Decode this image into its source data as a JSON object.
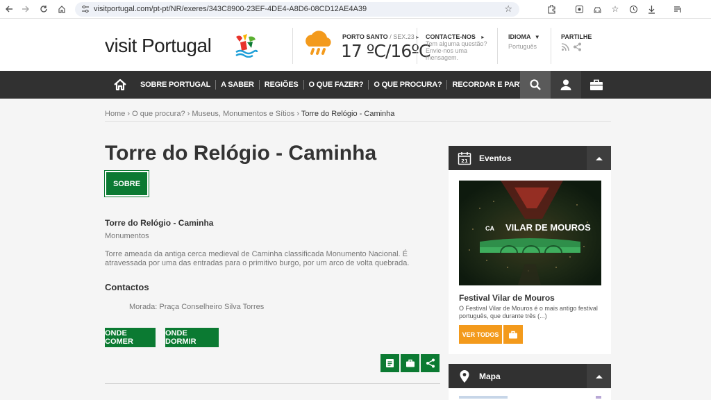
{
  "browser": {
    "url": "visitportugal.com/pt-pt/NR/exeres/343C8900-23EF-4DE4-A8D6-08CD12AE4A39"
  },
  "header": {
    "logo_text": "visit Portugal",
    "weather": {
      "city": "PORTO SANTO",
      "date": "/ SEX.23",
      "temperature": "17 ºC/16ºC"
    },
    "contact": {
      "title": "CONTACTE-NOS",
      "line1": "Tem alguma questão?",
      "line2": "Envie-nos uma",
      "line3": "mensagem."
    },
    "language": {
      "title": "IDIOMA",
      "value": "Português"
    },
    "share": {
      "title": "PARTILHE"
    }
  },
  "nav": {
    "items": [
      "SOBRE PORTUGAL",
      "A SABER",
      "REGIÕES",
      "O QUE FAZER?",
      "O QUE PROCURA?",
      "RECORDAR E PARTILHAR"
    ]
  },
  "breadcrumb": {
    "items": [
      "Home",
      "O que procura?",
      "Museus, Monumentos e Sítios"
    ],
    "current": "Torre do Relógio - Caminha",
    "sep": " › "
  },
  "main": {
    "title": "Torre do Relógio - Caminha",
    "sobre_label": "SOBRE",
    "subtitle": "Torre do Relógio - Caminha",
    "category": "Monumentos",
    "description": "Torre ameada da antiga cerca medieval de Caminha classificada Monumento Nacional. É atravessada por uma das entradas para o primitivo burgo, por um arco de volta quebrada.",
    "contacts_title": "Contactos",
    "address": "Morada: Praça Conselheiro Silva Torres",
    "onde_comer": "ONDE COMER",
    "onde_dormir": "ONDE DORMIR"
  },
  "events": {
    "title": "Eventos",
    "calendar_day": "21",
    "image_text": "VILAR DE MOUROS",
    "image_logo": "CA",
    "event_title": "Festival Vilar de Mouros",
    "event_desc": "O Festival Vilar de Mouros é o mais antigo festival português, que durante três (...)",
    "ver_todos": "VER TODOS"
  },
  "map": {
    "title": "Mapa"
  },
  "colors": {
    "green": "#0b7a32",
    "dark": "#313131",
    "orange": "#f39a1c"
  }
}
